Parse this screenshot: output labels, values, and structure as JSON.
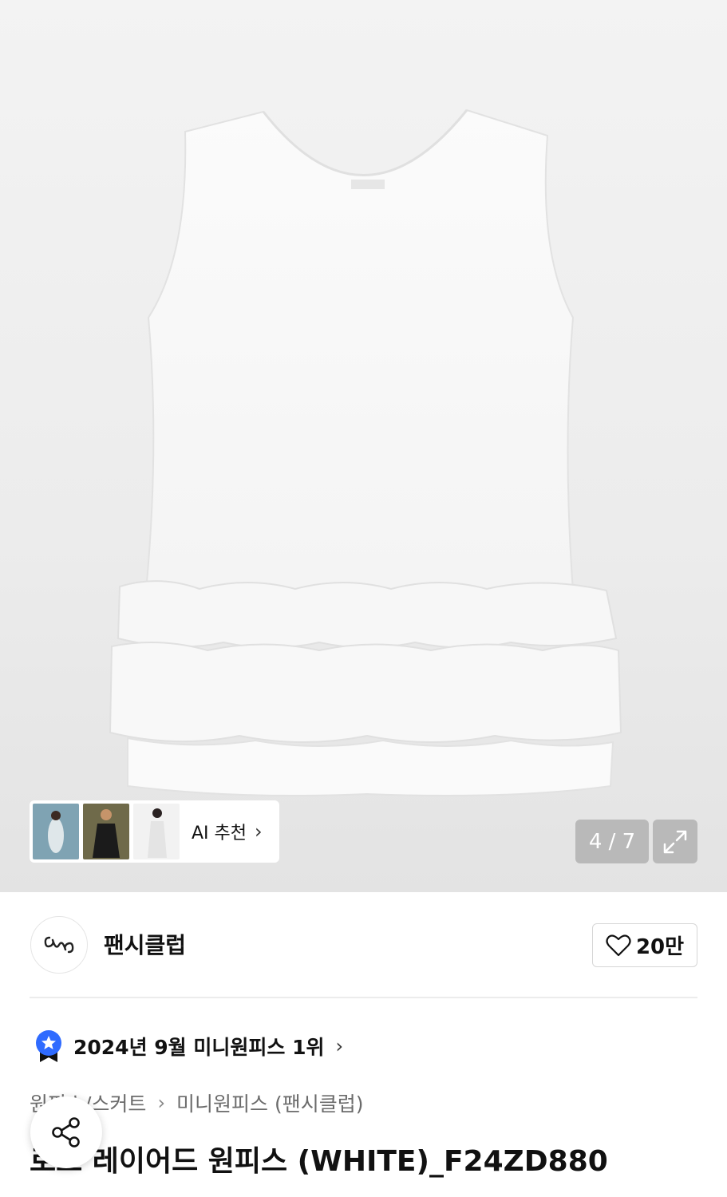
{
  "gallery": {
    "ai_recommend_label": "AI 추천",
    "counter": "4 / 7"
  },
  "brand": {
    "name": "팬시클럽",
    "likes": "20만"
  },
  "ranking": {
    "text": "2024년 9월 미니원피스 1위"
  },
  "breadcrumb": {
    "level1": "원피스/스커트",
    "level2": "미니원피스 (팬시클럽)"
  },
  "product": {
    "title": "로즈 레이어드 원피스 (WHITE)_F24ZD880"
  },
  "colors": {
    "accent_blue": "#2f6bff",
    "text_primary": "#111111",
    "text_secondary": "#6b6b6b"
  }
}
